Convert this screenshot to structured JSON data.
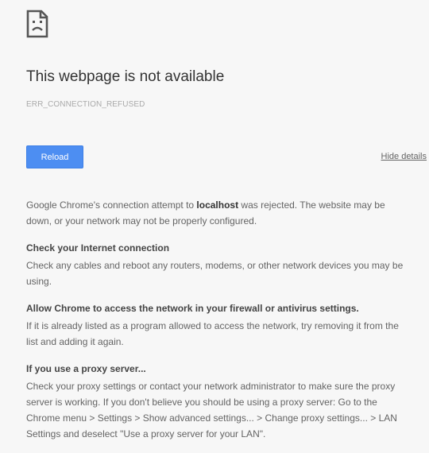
{
  "title": "This webpage is not available",
  "error_code": "ERR_CONNECTION_REFUSED",
  "reload_label": "Reload",
  "details_link_label": "Hide details",
  "intro": {
    "before": "Google Chrome's connection attempt to ",
    "host": "localhost",
    "after": " was rejected. The website may be down, or your network may not be properly configured."
  },
  "sections": [
    {
      "heading": "Check your Internet connection",
      "body": "Check any cables and reboot any routers, modems, or other network devices you may be using."
    },
    {
      "heading": "Allow Chrome to access the network in your firewall or antivirus settings.",
      "body": "If it is already listed as a program allowed to access the network, try removing it from the list and adding it again."
    },
    {
      "heading": "If you use a proxy server...",
      "body": "Check your proxy settings or contact your network administrator to make sure the proxy server is working. If you don't believe you should be using a proxy server: Go to the Chrome menu > Settings > Show advanced settings... > Change proxy settings... > LAN Settings and deselect \"Use a proxy server for your LAN\"."
    }
  ],
  "icon": "sad-page-icon",
  "colors": {
    "accent": "#4d8ef2",
    "background": "#f7f7f7"
  }
}
